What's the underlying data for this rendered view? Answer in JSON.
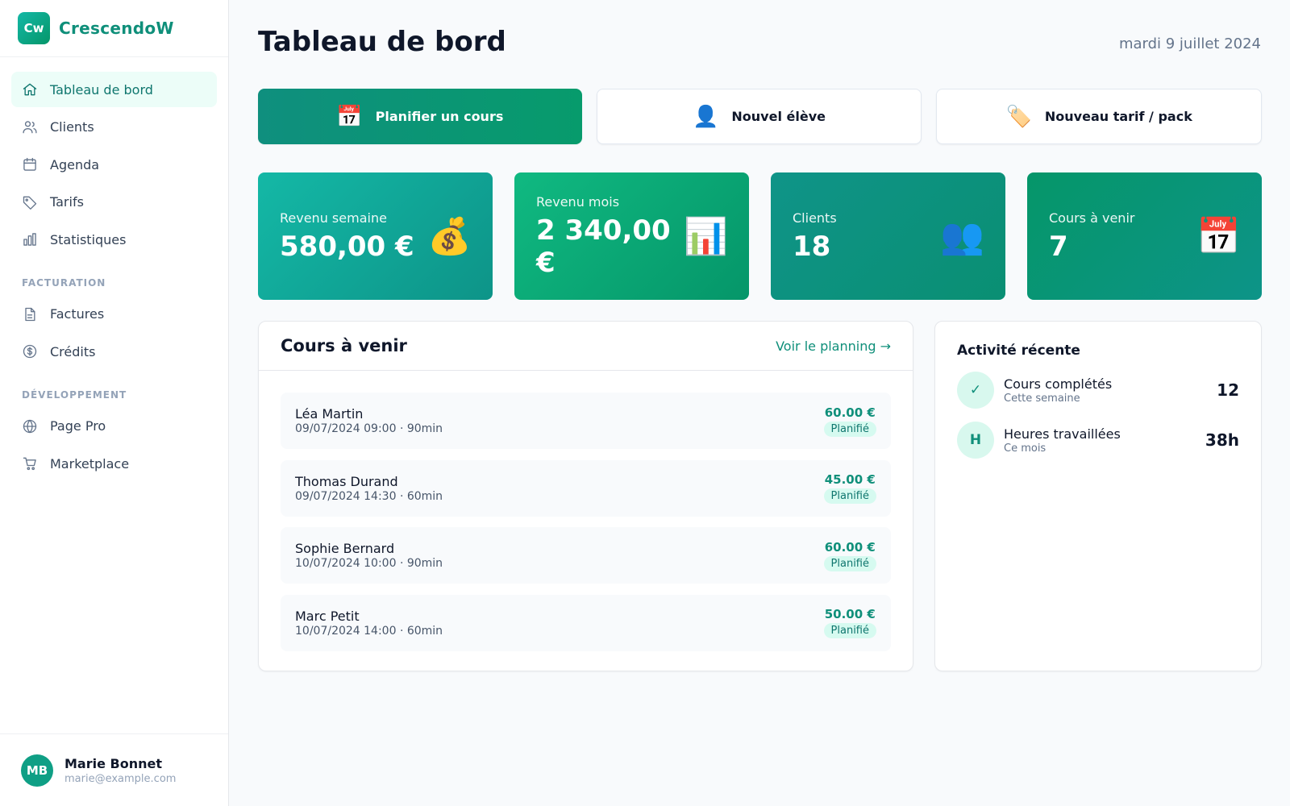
{
  "brand": {
    "logo": "Cw",
    "name": "CrescendoW"
  },
  "sidebar": {
    "items": [
      {
        "label": "Tableau de bord",
        "icon": "home-icon",
        "active": true
      },
      {
        "label": "Clients",
        "icon": "users-icon"
      },
      {
        "label": "Agenda",
        "icon": "calendar-icon"
      },
      {
        "label": "Tarifs",
        "icon": "tag-icon"
      },
      {
        "label": "Statistiques",
        "icon": "bar-chart-icon"
      }
    ],
    "sections": [
      {
        "title": "FACTURATION",
        "items": [
          {
            "label": "Factures",
            "icon": "document-icon"
          },
          {
            "label": "Crédits",
            "icon": "dollar-circle-icon"
          }
        ]
      },
      {
        "title": "DÉVELOPPEMENT",
        "items": [
          {
            "label": "Page Pro",
            "icon": "globe-icon"
          },
          {
            "label": "Marketplace",
            "icon": "cart-icon"
          }
        ]
      }
    ]
  },
  "user": {
    "initials": "MB",
    "name": "Marie Bonnet",
    "email": "marie@example.com"
  },
  "header": {
    "title": "Tableau de bord",
    "date": "mardi 9 juillet 2024"
  },
  "actions": [
    {
      "label": "Planifier un cours",
      "emoji": "📅"
    },
    {
      "label": "Nouvel élève",
      "emoji": "👤"
    },
    {
      "label": "Nouveau tarif / pack",
      "emoji": "🏷️"
    }
  ],
  "stats": [
    {
      "label": "Revenu semaine",
      "value": "580,00 €",
      "emoji": "💰"
    },
    {
      "label": "Revenu mois",
      "value": "2 340,00 €",
      "emoji": "📊"
    },
    {
      "label": "Clients",
      "value": "18",
      "emoji": "👥"
    },
    {
      "label": "Cours à venir",
      "value": "7",
      "emoji": "📅"
    }
  ],
  "upcoming": {
    "title": "Cours à venir",
    "link": "Voir le planning →",
    "rows": [
      {
        "name": "Léa Martin",
        "meta": "09/07/2024 09:00 · 90min",
        "price": "60.00 €",
        "status": "Planifié"
      },
      {
        "name": "Thomas Durand",
        "meta": "09/07/2024 14:30 · 60min",
        "price": "45.00 €",
        "status": "Planifié"
      },
      {
        "name": "Sophie Bernard",
        "meta": "10/07/2024 10:00 · 90min",
        "price": "60.00 €",
        "status": "Planifié"
      },
      {
        "name": "Marc Petit",
        "meta": "10/07/2024 14:00 · 60min",
        "price": "50.00 €",
        "status": "Planifié"
      }
    ]
  },
  "activity": {
    "title": "Activité récente",
    "items": [
      {
        "icon": "✓",
        "label": "Cours complétés",
        "sub": "Cette semaine",
        "value": "12"
      },
      {
        "icon": "H",
        "label": "Heures travaillées",
        "sub": "Ce mois",
        "value": "38h"
      }
    ]
  },
  "colors": {
    "accent": "#0f8f7a",
    "primary_gradient_start": "#0f8f7e",
    "primary_gradient_end": "#079b6c"
  }
}
